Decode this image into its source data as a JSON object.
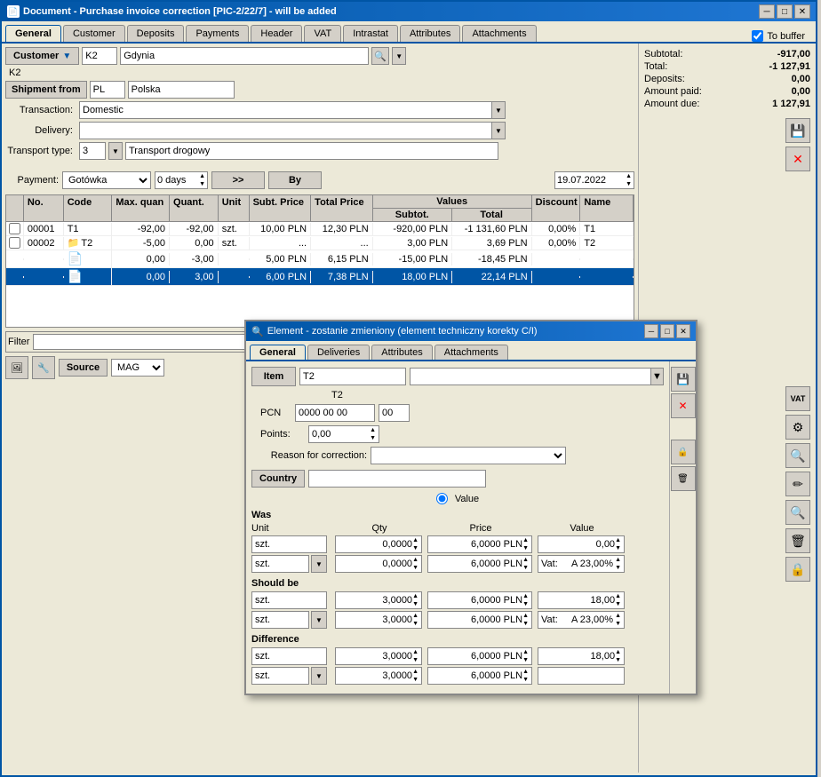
{
  "window": {
    "title": "Document - Purchase invoice correction [PIC-2/22/7] - will be added",
    "icon": "doc"
  },
  "tabs": {
    "items": [
      "General",
      "Customer",
      "Deposits",
      "Payments",
      "Header",
      "VAT",
      "Intrastat",
      "Attributes",
      "Attachments"
    ],
    "active": 0
  },
  "to_buffer": {
    "label": "To buffer",
    "checked": true
  },
  "customer": {
    "label": "Customer",
    "value": "K2",
    "city": "Gdynia",
    "sub_value": "K2"
  },
  "shipment_from": {
    "label": "Shipment from",
    "country_code": "PL",
    "country_name": "Polska"
  },
  "transaction": {
    "label": "Transaction:",
    "value": "Domestic"
  },
  "delivery": {
    "label": "Delivery:",
    "value": ""
  },
  "transport_type": {
    "label": "Transport type:",
    "value": "3",
    "description": "Transport drogowy"
  },
  "payment": {
    "label": "Payment:",
    "method": "Gotówka",
    "days": "0 days",
    "date": "19.07.2022",
    "by_label": "By"
  },
  "summary": {
    "subtotal_label": "Subtotal:",
    "subtotal_value": "-917,00",
    "total_label": "Total:",
    "total_value": "-1 127,91",
    "deposits_label": "Deposits:",
    "deposits_value": "0,00",
    "amount_paid_label": "Amount paid:",
    "amount_paid_value": "0,00",
    "amount_due_label": "Amount due:",
    "amount_due_value": "1 127,91"
  },
  "table": {
    "columns": [
      "No.",
      "Code",
      "Max. quan",
      "Quant.",
      "Unit",
      "Subt. Price",
      "Total Price",
      "Subtot.",
      "Total",
      "Discount",
      "Name"
    ],
    "rows": [
      {
        "no": "00001",
        "code": "T1",
        "max_quan": "-92,00",
        "quant": "-92,00",
        "unit": "szt.",
        "subt_price": "10,00 PLN",
        "total_price": "12,30 PLN",
        "subtot": "-920,00 PLN",
        "total": "-1 131,60 PLN",
        "discount": "0,00%",
        "name": "T1",
        "selected": false,
        "checked": false
      },
      {
        "no": "00002",
        "code": "T2",
        "max_quan": "-5,00",
        "quant": "0,00",
        "unit": "szt.",
        "subt_price": "...",
        "total_price": "...",
        "subtot": "3,00 PLN",
        "total": "3,69 PLN",
        "discount": "0,00%",
        "name": "T2",
        "selected": false,
        "checked": false
      },
      {
        "no": "",
        "code": "",
        "max_quan": "0,00",
        "quant": "-3,00",
        "unit": "",
        "subt_price": "5,00 PLN",
        "total_price": "6,15 PLN",
        "subtot": "-15,00 PLN",
        "total": "-18,45 PLN",
        "discount": "",
        "name": "",
        "selected": false,
        "checked": false
      },
      {
        "no": "",
        "code": "",
        "max_quan": "0,00",
        "quant": "3,00",
        "unit": "",
        "subt_price": "6,00 PLN",
        "total_price": "7,38 PLN",
        "subtot": "18,00 PLN",
        "total": "22,14 PLN",
        "discount": "",
        "name": "",
        "selected": true,
        "checked": false
      }
    ]
  },
  "filter": {
    "label": "Filter",
    "source_label": "Source",
    "source_value": "MAG"
  },
  "dialog": {
    "title": "Element - zostanie zmieniony (element techniczny korekty C/I)",
    "tabs": [
      "General",
      "Deliveries",
      "Attributes",
      "Attachments"
    ],
    "active_tab": 0,
    "item": {
      "label": "Item",
      "value": "T2",
      "description": "T2"
    },
    "pcn": {
      "label": "PCN",
      "value1": "0000 00 00",
      "value2": "00"
    },
    "points": {
      "label": "Points:",
      "value": "0,00"
    },
    "reason_for_correction": {
      "label": "Reason for correction:",
      "value": ""
    },
    "country": {
      "label": "Country",
      "value": ""
    },
    "value_radio": "Value",
    "was": {
      "label": "Was",
      "unit_header": "Unit",
      "qty_header": "Qty",
      "price_header": "Price",
      "value_header": "Value",
      "row1": {
        "unit": "szt.",
        "qty": "0,0000",
        "price": "6,0000 PLN",
        "value": "0,00"
      },
      "row2": {
        "unit": "szt.",
        "qty": "0,0000",
        "price": "6,0000 PLN",
        "vat_label": "Vat:",
        "vat_value": "A 23,00%"
      }
    },
    "should_be": {
      "label": "Should be",
      "row1": {
        "unit": "szt.",
        "qty": "3,0000",
        "price": "6,0000 PLN",
        "value": "18,00"
      },
      "row2": {
        "unit": "szt.",
        "qty": "3,0000",
        "price": "6,0000 PLN",
        "vat_label": "Vat:",
        "vat_value": "A 23,00%"
      }
    },
    "difference": {
      "label": "Difference",
      "row1": {
        "unit": "szt.",
        "qty": "3,0000",
        "price": "6,0000 PLN",
        "value": "18,00"
      },
      "row2": {
        "unit": "szt.",
        "qty": "3,0000",
        "price": "6,0000 PLN"
      }
    },
    "save_btn": "💾",
    "cancel_btn": "✕",
    "lock_btn": "🔒"
  }
}
